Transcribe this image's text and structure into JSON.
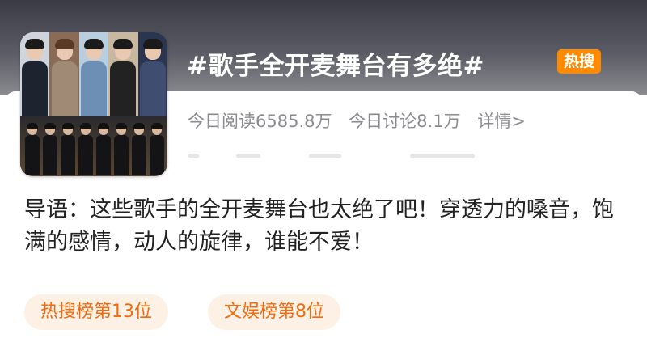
{
  "topic": {
    "title": "#歌手全开麦舞台有多绝#",
    "badge": "热搜"
  },
  "stats": {
    "reads": "今日阅读6585.8万",
    "discussions": "今日讨论8.1万",
    "detail_link": "详情>"
  },
  "intro": {
    "text": "导语：这些歌手的全开麦舞台也太绝了吧！穿透力的嗓音，饱满的感情，动人的旋律，谁能不爱！"
  },
  "tags": [
    {
      "label": "热搜榜第13位"
    },
    {
      "label": "文娱榜第8位"
    }
  ],
  "colors": {
    "badge_bg": "#ff8a00",
    "tag_bg": "#fdf1e6",
    "tag_text": "#f06a0e",
    "stats_text": "#8a8a8f"
  }
}
